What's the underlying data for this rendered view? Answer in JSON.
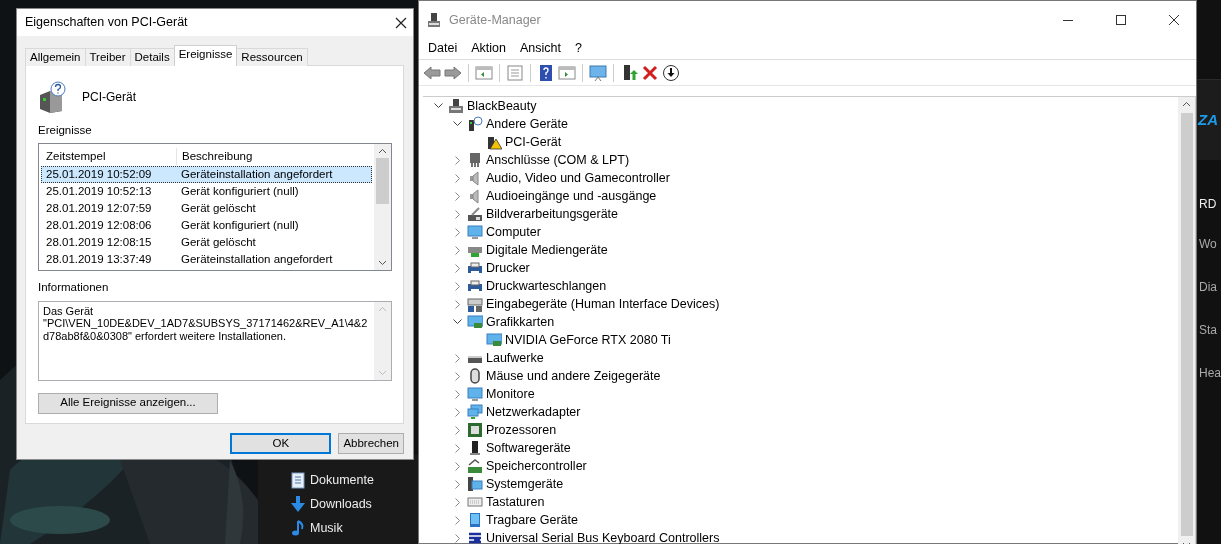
{
  "explorer_sidebar": {
    "items": [
      {
        "label": "Dokumente",
        "kind": "document"
      },
      {
        "label": "Downloads",
        "kind": "download"
      },
      {
        "label": "Musik",
        "kind": "music"
      }
    ]
  },
  "background_app": {
    "logo": "ZA",
    "heading": "RD",
    "items": [
      "Wo",
      "Dia",
      "Sta",
      "Hea"
    ]
  },
  "properties_dialog": {
    "title": "Eigenschaften von PCI-Gerät",
    "tabs": [
      {
        "label": "Allgemein",
        "selected": false
      },
      {
        "label": "Treiber",
        "selected": false
      },
      {
        "label": "Details",
        "selected": false
      },
      {
        "label": "Ereignisse",
        "selected": true
      },
      {
        "label": "Ressourcen",
        "selected": false
      }
    ],
    "device_name": "PCI-Gerät",
    "events_label": "Ereignisse",
    "events_columns": [
      "Zeitstempel",
      "Beschreibung"
    ],
    "events": [
      {
        "timestamp": "25.01.2019 10:52:09",
        "description": "Geräteinstallation angefordert",
        "selected": true
      },
      {
        "timestamp": "25.01.2019 10:52:13",
        "description": "Gerät konfiguriert (null)",
        "selected": false
      },
      {
        "timestamp": "28.01.2019 12:07:59",
        "description": "Gerät gelöscht",
        "selected": false
      },
      {
        "timestamp": "28.01.2019 12:08:06",
        "description": "Gerät konfiguriert (null)",
        "selected": false
      },
      {
        "timestamp": "28.01.2019 12:08:15",
        "description": "Gerät gelöscht",
        "selected": false
      },
      {
        "timestamp": "28.01.2019 13:37:49",
        "description": "Geräteinstallation angefordert",
        "selected": false
      }
    ],
    "info_label": "Informationen",
    "info_text": "Das Gerät \"PCI\\VEN_10DE&DEV_1AD7&SUBSYS_37171462&REV_A1\\4&2d78ab8f&0&0308\" erfordert weitere Installationen.",
    "all_events_button": "Alle Ereignisse anzeigen...",
    "buttons": [
      {
        "label": "OK",
        "default": true
      },
      {
        "label": "Abbrechen",
        "default": false
      }
    ]
  },
  "device_manager": {
    "title": "Geräte-Manager",
    "menu": [
      "Datei",
      "Aktion",
      "Ansicht",
      "?"
    ],
    "tree": {
      "label": "BlackBeauty",
      "kind": "computer",
      "expanded": true,
      "children": [
        {
          "label": "Andere Geräte",
          "kind": "unknown",
          "expanded": true,
          "children": [
            {
              "label": "PCI-Gerät",
              "kind": "warning"
            }
          ]
        },
        {
          "label": "Anschlüsse (COM & LPT)",
          "kind": "port",
          "expanded": false
        },
        {
          "label": "Audio, Video und Gamecontroller",
          "kind": "audio",
          "expanded": false
        },
        {
          "label": "Audioeingänge und -ausgänge",
          "kind": "audio",
          "expanded": false
        },
        {
          "label": "Bildverarbeitungsgeräte",
          "kind": "camera",
          "expanded": false
        },
        {
          "label": "Computer",
          "kind": "monitor",
          "expanded": false
        },
        {
          "label": "Digitale Mediengeräte",
          "kind": "media",
          "expanded": false
        },
        {
          "label": "Drucker",
          "kind": "printer",
          "expanded": false
        },
        {
          "label": "Druckwarteschlangen",
          "kind": "printer",
          "expanded": false
        },
        {
          "label": "Eingabegeräte (Human Interface Devices)",
          "kind": "hid",
          "expanded": false
        },
        {
          "label": "Grafikkarten",
          "kind": "display",
          "expanded": true,
          "children": [
            {
              "label": "NVIDIA GeForce RTX 2080 Ti",
              "kind": "display"
            }
          ]
        },
        {
          "label": "Laufwerke",
          "kind": "drive",
          "expanded": false
        },
        {
          "label": "Mäuse und andere Zeigegeräte",
          "kind": "mouse",
          "expanded": false
        },
        {
          "label": "Monitore",
          "kind": "monitor",
          "expanded": false
        },
        {
          "label": "Netzwerkadapter",
          "kind": "network",
          "expanded": false
        },
        {
          "label": "Prozessoren",
          "kind": "cpu",
          "expanded": false
        },
        {
          "label": "Softwaregeräte",
          "kind": "software",
          "expanded": false
        },
        {
          "label": "Speichercontroller",
          "kind": "storage",
          "expanded": false
        },
        {
          "label": "Systemgeräte",
          "kind": "system",
          "expanded": false
        },
        {
          "label": "Tastaturen",
          "kind": "keyboard",
          "expanded": false
        },
        {
          "label": "Tragbare Geräte",
          "kind": "portable",
          "expanded": false
        },
        {
          "label": "Universal Serial Bus Keyboard Controllers",
          "kind": "usb",
          "expanded": false
        }
      ]
    }
  }
}
